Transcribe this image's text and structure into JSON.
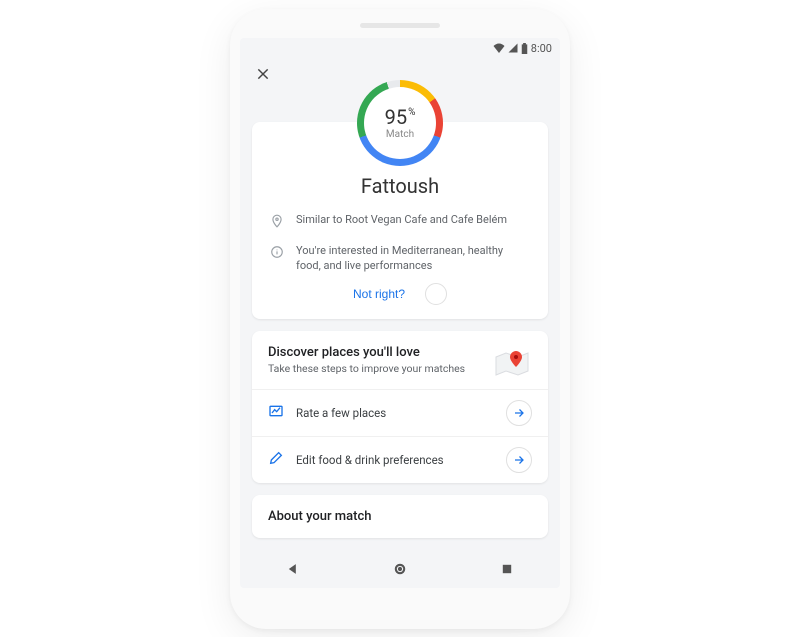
{
  "status": {
    "time": "8:00"
  },
  "match": {
    "percent": "95",
    "percent_symbol": "%",
    "label": "Match",
    "place_name": "Fattoush",
    "similar_text": "Similar to Root Vegan Cafe and Cafe Belém",
    "interest_text": "You're interested in Mediterranean, healthy food, and live performances",
    "not_right": "Not right?"
  },
  "discover": {
    "title": "Discover places you'll love",
    "subtitle": "Take these steps to improve your matches",
    "actions": {
      "rate": "Rate a few places",
      "edit": "Edit food & drink preferences"
    }
  },
  "about": {
    "title": "About your match"
  },
  "colors": {
    "blue": "#4285F4",
    "red": "#EA4335",
    "yellow": "#FBBC05",
    "green": "#34A853"
  }
}
